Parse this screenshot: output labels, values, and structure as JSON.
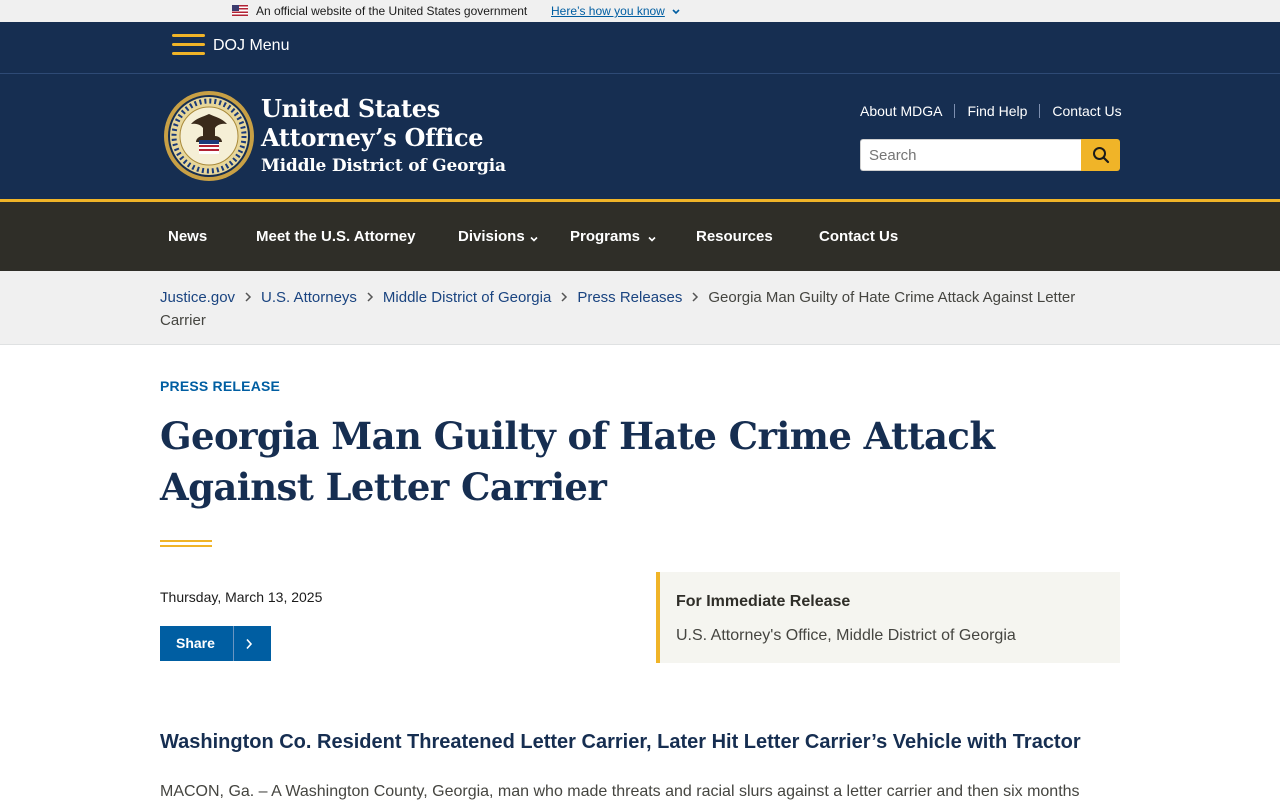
{
  "gov_banner": {
    "text": "An official website of the United States government",
    "link": "Here’s how you know",
    "flag_icon": "us-flag-icon"
  },
  "doj_menu": {
    "label": "DOJ Menu",
    "icon": "hamburger-icon"
  },
  "header": {
    "title_line1": "United States",
    "title_line2": "Attorney’s Office",
    "subtitle": "Middle District of Georgia",
    "seal_icon": "doj-seal-icon",
    "util_links": [
      "About MDGA",
      "Find Help",
      "Contact Us"
    ],
    "search_placeholder": "Search",
    "search_icon": "search-icon"
  },
  "nav": {
    "items": [
      "News",
      "Meet the U.S. Attorney",
      "Divisions",
      "Programs",
      "Resources",
      "Contact Us"
    ]
  },
  "breadcrumb": {
    "links": [
      "Justice.gov",
      "U.S. Attorneys",
      "Middle District of Georgia",
      "Press Releases"
    ],
    "current": "Georgia Man Guilty of Hate Crime Attack Against Letter Carrier"
  },
  "article": {
    "label": "PRESS RELEASE",
    "title": "Georgia Man Guilty of Hate Crime Attack Against Letter Carrier",
    "date": "Thursday, March 13, 2025",
    "share_label": "Share",
    "release_heading": "For Immediate Release",
    "release_office": "U.S. Attorney's Office, Middle District of Georgia",
    "subhead": "Washington Co. Resident Threatened Letter Carrier, Later Hit Letter Carrier’s Vehicle with Tractor",
    "body": "MACON, Ga. – A Washington County, Georgia, man who made threats and racial slurs against a letter carrier and then six months"
  },
  "colors": {
    "navy": "#162e51",
    "gold": "#f0b428",
    "dark_nav": "#2f2e28",
    "link_blue": "#005ea2"
  }
}
